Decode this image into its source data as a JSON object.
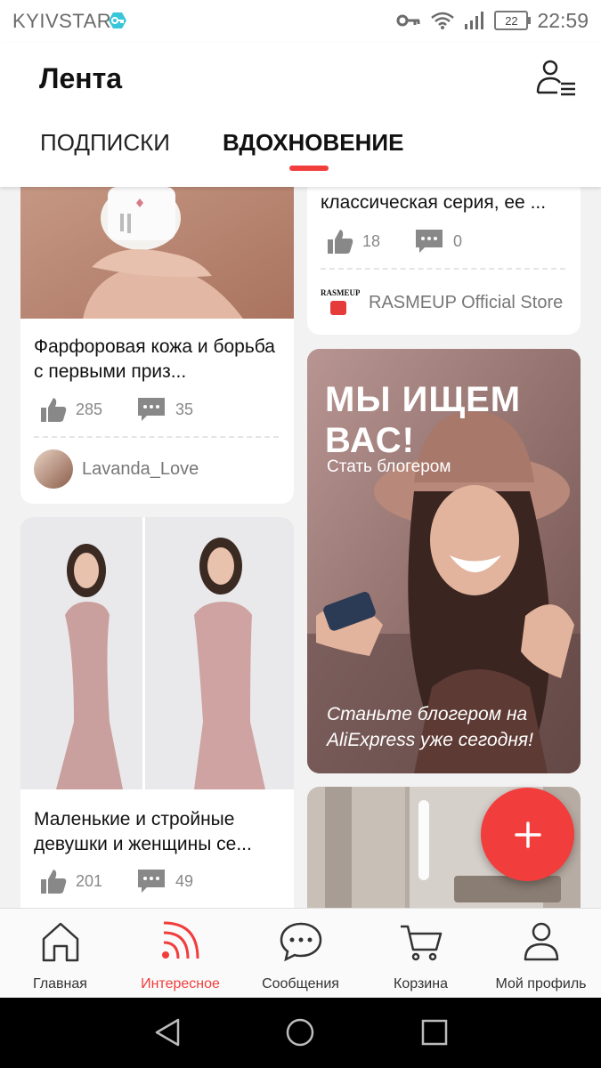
{
  "status_bar": {
    "carrier": "KYIVSTAR",
    "battery": "22",
    "time": "22:59",
    "icons": [
      "vpn-key-icon",
      "key-icon",
      "wifi-icon",
      "signal-icon",
      "battery-icon"
    ]
  },
  "header": {
    "title": "Лента",
    "tabs": [
      {
        "label": "ПОДПИСКИ",
        "active": false
      },
      {
        "label": "ВДОХНОВЕНИЕ",
        "active": true
      }
    ]
  },
  "accent_color": "#f23d3d",
  "feed": {
    "left": [
      {
        "title": "Фарфоровая кожа и борьба с первыми приз...",
        "likes": "285",
        "comments": "35",
        "author": "Lavanda_Love"
      },
      {
        "title": "Маленькие и стройные девушки и женщины  се...",
        "likes": "201",
        "comments": "49"
      }
    ],
    "right": [
      {
        "title": "классическая серия, ее ...",
        "likes": "18",
        "comments": "0",
        "author": "RASMEUP Official Store",
        "author_logo_text": "RASMEUP"
      },
      {
        "banner_heading": "МЫ ИЩЕМ ВАС!",
        "banner_sub": "Стать блогером",
        "banner_bottom": "Станьте блогером на AliExpress уже сегодня!"
      }
    ]
  },
  "fab": {
    "icon": "plus-icon"
  },
  "bottom_nav": [
    {
      "label": "Главная",
      "icon": "home-icon",
      "active": false
    },
    {
      "label": "Интересное",
      "icon": "feed-icon",
      "active": true
    },
    {
      "label": "Сообщения",
      "icon": "chat-icon",
      "active": false
    },
    {
      "label": "Корзина",
      "icon": "cart-icon",
      "active": false
    },
    {
      "label": "Мой профиль",
      "icon": "profile-icon",
      "active": false
    }
  ],
  "system_nav": [
    "back-icon",
    "home-circle-icon",
    "recents-icon"
  ]
}
